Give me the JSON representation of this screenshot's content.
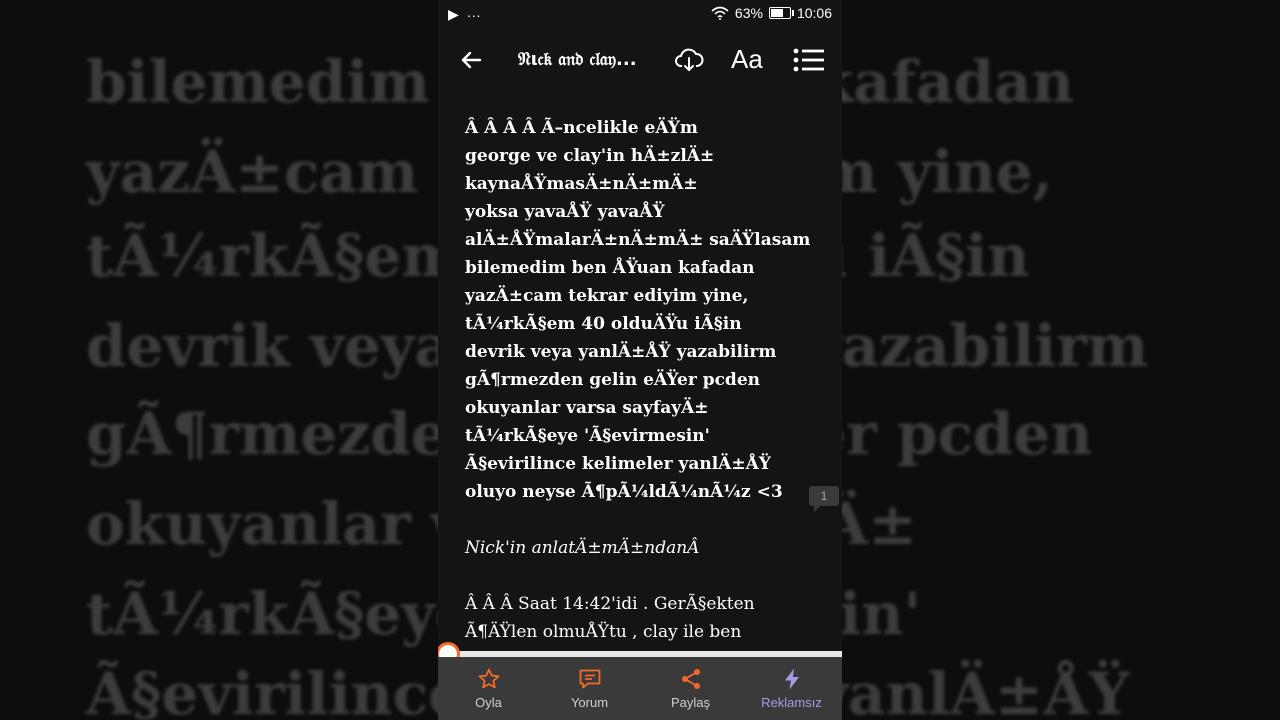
{
  "background_lines": [
    "bilemedim ben ÅŸuan kafadan",
    "yazÄ±cam tekrar ediyim yine,",
    "tÃ¼rkÃ§em 40 olduÄŸu iÃ§in",
    "devrik veya yanlÄ±ÅŸ yazabilirm",
    "gÃ¶rmezden gelin eÄŸer pcden",
    "okuyanlar varsa sayfayÄ±",
    "tÃ¼rkÃ§eye 'Ã§evirmesin'",
    "Ã§evirilince kelimeler yanlÄ±ÅŸ"
  ],
  "status": {
    "battery": "63%",
    "time": "10:06",
    "dots": "···"
  },
  "toolbar": {
    "title": "𝔑ι𝔠𝔨 𝔞𝔫𝔡 𝔠𝔩𝔞𝔶...",
    "font_button": "Aa"
  },
  "story": {
    "p1": [
      "Â  Â  Â  Â Ã–ncelikle eÄŸm",
      "george ve clay'in hÄ±zlÄ±",
      "kaynaÅŸmasÄ±nÄ±mÄ±",
      "yoksa yavaÅŸ yavaÅŸ",
      "alÄ±ÅŸmalarÄ±nÄ±mÄ± saÄŸlasam",
      "bilemedim ben ÅŸuan kafadan",
      "yazÄ±cam tekrar ediyim yine,",
      "tÃ¼rkÃ§em 40 olduÄŸu iÃ§in",
      "devrik veya yanlÄ±ÅŸ yazabilirm",
      "gÃ¶rmezden gelin eÄŸer pcden",
      "okuyanlar varsa sayfayÄ±",
      "tÃ¼rkÃ§eye 'Ã§evirmesin'",
      "Ã§evirilince kelimeler yanlÄ±ÅŸ",
      "oluyo neyse Ã¶pÃ¼ldÃ¼nÃ¼z <3"
    ],
    "p2": "Nick'in anlatÄ±mÄ±ndanÂ",
    "p3": [
      "Â  Â  Â Saat 14:42'idi . GerÃ§ekten",
      "Ã¶ÄŸlen olmuÅŸtu , clay ile ben"
    ]
  },
  "comment_count": "1",
  "reading_progress": 0.0,
  "bottom": {
    "vote": "Oyla",
    "comment": "Yorum",
    "share": "Paylaş",
    "adfree": "Reklamsız"
  },
  "colors": {
    "accent": "#f36a2a",
    "promo": "#a99ae8",
    "bar_bg": "#3a3a3a"
  }
}
